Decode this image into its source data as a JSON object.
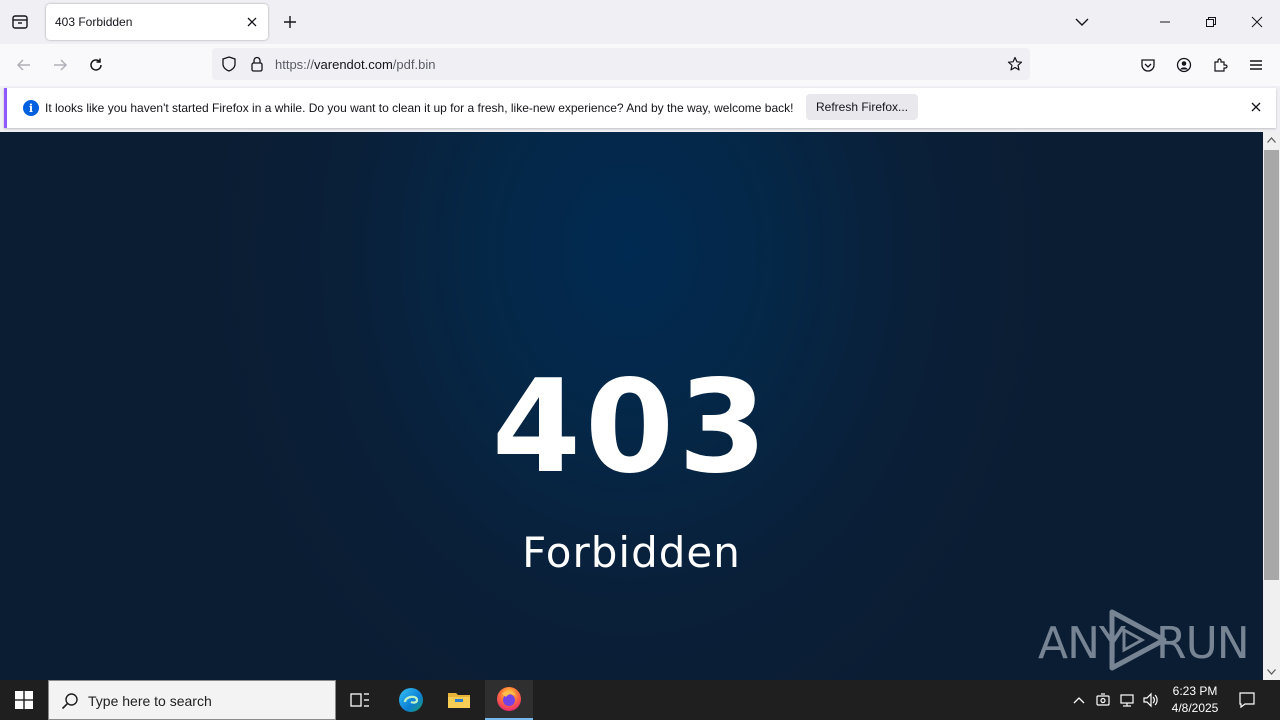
{
  "browser": {
    "tab": {
      "title": "403 Forbidden"
    },
    "url": {
      "prefix": "https://",
      "host": "varendot.com",
      "path": "/pdf.bin"
    }
  },
  "notification": {
    "message": "It looks like you haven't started Firefox in a while. Do you want to clean it up for a fresh, like-new experience? And by the way, welcome back!",
    "button": "Refresh Firefox..."
  },
  "page": {
    "code": "403",
    "message": "Forbidden"
  },
  "watermark": {
    "left": "ANY",
    "right": "RUN"
  },
  "taskbar": {
    "search_placeholder": "Type here to search",
    "time": "6:23 PM",
    "date": "4/8/2025"
  },
  "colors": {
    "accent": "#9059ff",
    "info": "#0060df",
    "page_bg": "#0b1d33",
    "taskbar": "#1f1f1f"
  }
}
